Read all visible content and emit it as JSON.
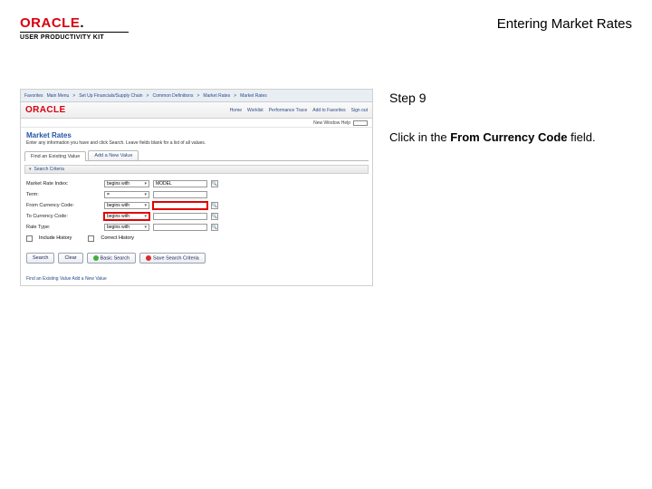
{
  "header": {
    "logo_text": "ORACLE",
    "logo_sub": "USER PRODUCTIVITY KIT",
    "page_title": "Entering Market Rates"
  },
  "instruction": {
    "step_label": "Step 9",
    "text_prefix": "Click in the ",
    "text_bold": "From Currency Code",
    "text_suffix": " field."
  },
  "shot": {
    "breadcrumb": {
      "items": [
        "Favorites",
        "Main Menu",
        "Set Up Financials/Supply Chain",
        "Common Definitions",
        "Market Rates",
        "Market Rates"
      ]
    },
    "brand_links": [
      "Home",
      "Worklist",
      "Performance Trace",
      "Add to Favorites",
      "Sign out"
    ],
    "user_line": "New Window   Help",
    "heading": "Market Rates",
    "description": "Enter any information you have and click Search. Leave fields blank for a list of all values.",
    "tabs": {
      "a": "Find an Existing Value",
      "b": "Add a New Value"
    },
    "section": "Search Criteria",
    "form": {
      "mri_label": "Market Rate Index:",
      "mri_op": "begins with",
      "mri_val": "MODEL",
      "term_label": "Term:",
      "term_op": "=",
      "from_label": "From Currency Code:",
      "from_op": "begins with",
      "to_label": "To Currency Code:",
      "to_op": "begins with",
      "type_label": "Rate Type:",
      "type_op": "begins with",
      "hist_label": "Include History",
      "corr_label": "Correct History"
    },
    "buttons": {
      "search": "Search",
      "clear": "Clear",
      "basic": "Basic Search",
      "save": "Save Search Criteria"
    },
    "footer": "Find an Existing Value   Add a New Value"
  }
}
